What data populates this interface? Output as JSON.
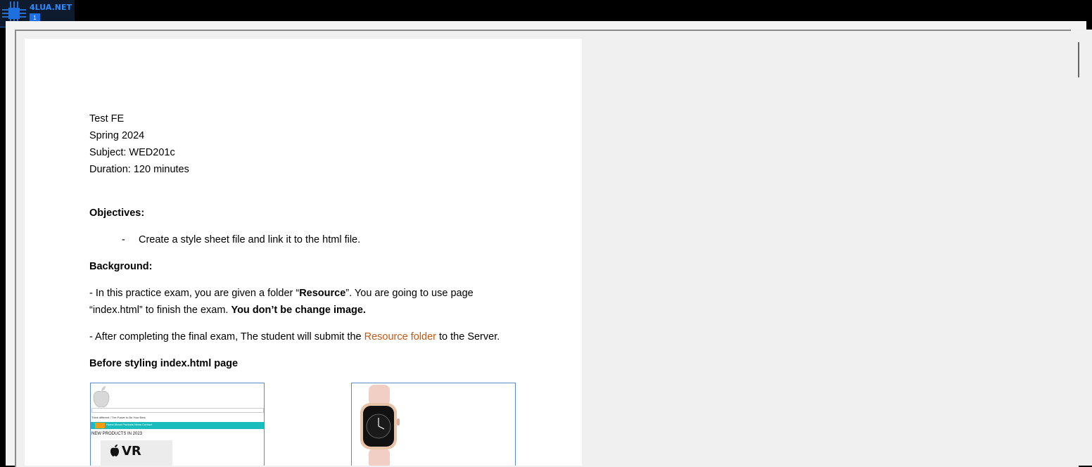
{
  "header": {
    "logo_text": "4LUA.NET",
    "logo_badge": "1"
  },
  "document": {
    "lines": [
      "Test FE",
      "Spring 2024",
      "Subject: WED201c",
      "Duration: 120 minutes"
    ],
    "objectives_heading": "Objectives:",
    "objectives_item": "Create a style sheet file and link it to the html file.",
    "background_heading": "Background:",
    "background_p1_a": "-  In this practice exam, you are given a folder “",
    "background_p1_b": "Resource",
    "background_p1_c": "”. You are going to use page",
    "background_p1_d": "“index.html”  to finish the exam. ",
    "background_p1_e": "You don’t be change image.",
    "background_p2_a": "-  After completing the final exam, The student will submit the ",
    "background_p2_b": "Resource folder",
    "background_p2_c": " to the Server.",
    "before_heading": "Before styling index.html page"
  },
  "thumbnail_index": {
    "tagline": "Think different / The Power to Be Your Best",
    "nav_items": "Home   About   Products   News   Contact",
    "heading": "NEW PRODUCTS IN 2023",
    "vr_label": "VR"
  },
  "colors": {
    "accent_orange": "#c45911",
    "nav_teal": "#1bbcbc",
    "nav_home": "#f39c12"
  }
}
